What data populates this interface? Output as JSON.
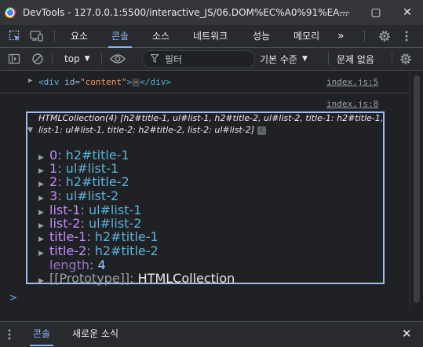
{
  "window": {
    "title": "DevTools - 127.0.0.1:5500/interactive_JS/06.DOM%EC%A0%91%EA...",
    "controls": [
      "—",
      "▢",
      "✕"
    ]
  },
  "tabs": {
    "items": [
      {
        "label": "요소",
        "active": false
      },
      {
        "label": "콘솔",
        "active": true
      },
      {
        "label": "소스",
        "active": false
      },
      {
        "label": "네트워크",
        "active": false
      },
      {
        "label": "성능",
        "active": false
      },
      {
        "label": "메모리",
        "active": false
      }
    ],
    "more": "»"
  },
  "toolbar": {
    "context": "top",
    "filter_placeholder": "필터",
    "levels": "기본 수준",
    "issues": "문제 없음"
  },
  "console": {
    "row1": {
      "open": "<div",
      "attr_name": "id",
      "eq": "=",
      "attr_value": "\"content\"",
      "close": ">",
      "ellipsis": "⋯",
      "end": "</div>",
      "source": "index.js:5"
    },
    "row2": {
      "source": "index.js:8"
    },
    "collection_head": "HTMLCollection(4) [h2#title-1, ul#list-1, h2#title-2, ul#list-2, title-1: h2#title-1, list-1: ul#list-1, title-2: h2#title-2, list-2: ul#list-2]",
    "entries": [
      {
        "key": "0",
        "value": "h2#title-1"
      },
      {
        "key": "1",
        "value": "ul#list-1"
      },
      {
        "key": "2",
        "value": "h2#title-2"
      },
      {
        "key": "3",
        "value": "ul#list-2"
      },
      {
        "key": "list-1",
        "value": "ul#list-1"
      },
      {
        "key": "list-2",
        "value": "ul#list-2"
      },
      {
        "key": "title-1",
        "value": "h2#title-1"
      },
      {
        "key": "title-2",
        "value": "h2#title-2"
      }
    ],
    "length": {
      "key": "length",
      "value": "4"
    },
    "prototype": {
      "key": "[[Prototype]]",
      "value": "HTMLCollection"
    },
    "prompt": ">"
  },
  "drawer": {
    "tabs": [
      "콘솔",
      "새로운 소식"
    ]
  }
}
